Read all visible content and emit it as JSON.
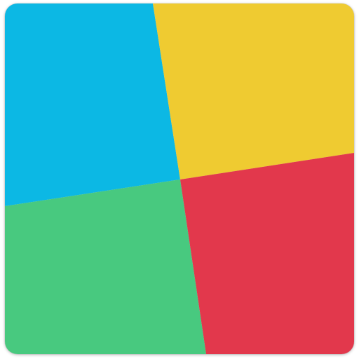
{
  "icon": {
    "name": "four-color-tile-icon",
    "quadrants": [
      {
        "name": "top-left",
        "color": "#0CB8E4"
      },
      {
        "name": "top-right",
        "color": "#EFCB31"
      },
      {
        "name": "bottom-left",
        "color": "#48C97F"
      },
      {
        "name": "bottom-right",
        "color": "#E2384C"
      }
    ]
  }
}
